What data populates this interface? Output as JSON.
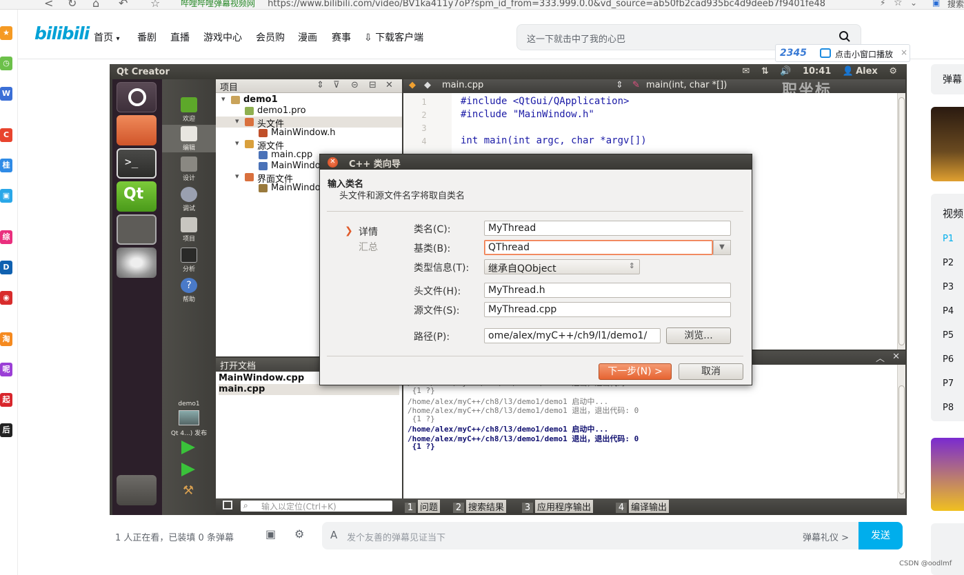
{
  "browser": {
    "site_label": "哔哩哔哩弹幕视频网",
    "url": "https://www.bilibili.com/video/BV1ka411y7oP?spm_id_from=333.999.0.0&vd_source=ab50fb2cad935bc4d9deeb7f9401fe48",
    "search_partial": "搜索"
  },
  "header": {
    "logo": "bilibili",
    "nav": [
      "首页",
      "番剧",
      "直播",
      "游戏中心",
      "会员购",
      "漫画",
      "赛事",
      "下载客户端"
    ],
    "search_placeholder": "这一下就击中了我的心巴",
    "pip_brand": "2345",
    "pip_label": "点击小窗口播放",
    "pip_close": "×"
  },
  "left_strip": {
    "icons": [
      {
        "name": "favorite-star-icon",
        "glyph": "★",
        "color": "#f59a23"
      },
      {
        "name": "clock-icon",
        "glyph": "◷",
        "color": "#6cc04a"
      },
      {
        "name": "pdf-to-word-icon",
        "glyph": "W",
        "color": "#3b6fd6"
      },
      {
        "name": "c-app-icon",
        "glyph": "C",
        "color": "#e8442e"
      },
      {
        "name": "gui-app-icon",
        "glyph": "桂",
        "color": "#2f8be6"
      },
      {
        "name": "bilibili-tv-icon",
        "glyph": "▣",
        "color": "#2aa7e8"
      },
      {
        "name": "pink-app-icon",
        "glyph": "综",
        "color": "#ea2f7e"
      },
      {
        "name": "decathlon-icon",
        "glyph": "D",
        "color": "#1061b0"
      },
      {
        "name": "red-circle-app-icon",
        "glyph": "◉",
        "color": "#d82c2c"
      },
      {
        "name": "orange-app-icon",
        "glyph": "淘",
        "color": "#f58a1f"
      },
      {
        "name": "purple-app-icon",
        "glyph": "呢",
        "color": "#9b3fd6"
      },
      {
        "name": "qidian-icon",
        "glyph": "起",
        "color": "#d8262c"
      },
      {
        "name": "black-app-icon",
        "glyph": "后",
        "color": "#222222"
      }
    ]
  },
  "qt": {
    "topbar_title": "Qt Creator",
    "topbar_time": "10:41",
    "topbar_user": "Alex",
    "modes": [
      "欢迎",
      "编辑",
      "设计",
      "调试",
      "项目",
      "分析",
      "帮助"
    ],
    "project_name": "demo1",
    "build_target": "Qt 4...) 发布",
    "project_header": "项目",
    "tree": [
      {
        "label": "demo1",
        "indent": 0,
        "bold": true,
        "expander": "▾",
        "icon": "#c9a35a"
      },
      {
        "label": "demo1.pro",
        "indent": 1,
        "bold": false,
        "expander": "",
        "icon": "#8fb050"
      },
      {
        "label": "头文件",
        "indent": 1,
        "bold": false,
        "expander": "▾",
        "icon": "#d9703d",
        "selected": true
      },
      {
        "label": "MainWindow.h",
        "indent": 2,
        "bold": false,
        "expander": "",
        "icon": "#c0502a"
      },
      {
        "label": "源文件",
        "indent": 1,
        "bold": false,
        "expander": "▾",
        "icon": "#d9a03d"
      },
      {
        "label": "main.cpp",
        "indent": 2,
        "bold": false,
        "expander": "",
        "icon": "#4a72b8"
      },
      {
        "label": "MainWindow.cpp",
        "indent": 2,
        "bold": false,
        "expander": "",
        "icon": "#4a72b8"
      },
      {
        "label": "界面文件",
        "indent": 1,
        "bold": false,
        "expander": "▾",
        "icon": "#d9703d"
      },
      {
        "label": "MainWindow.ui",
        "indent": 2,
        "bold": false,
        "expander": "",
        "icon": "#9a7a3d"
      }
    ],
    "open_docs_header": "打开文档",
    "open_docs": [
      "MainWindow.cpp",
      "main.cpp"
    ],
    "editor_file": "main.cpp",
    "editor_function": "main(int, char *[])",
    "code_lines": [
      {
        "n": "1",
        "text": "#include <QtGui/QApplication>"
      },
      {
        "n": "2",
        "text": "#include \"MainWindow.h\""
      },
      {
        "n": "3",
        "text": ""
      },
      {
        "n": "4",
        "text": "int main(int argc, char *argv[])"
      }
    ],
    "output_lines": [
      {
        "text": "/home/alex/myC++/ch8/l3/demo1/demo1 启动中...",
        "bold": false
      },
      {
        "text": "/home/alex/myC++/ch8/l3/demo1/demo1 退出，退出代码: 0",
        "bold": false
      },
      {
        "text": " {1 ?}",
        "bold": false
      },
      {
        "text": "/home/alex/myC++/ch8/l3/demo1/demo1 启动中...",
        "bold": false
      },
      {
        "text": "/home/alex/myC++/ch8/l3/demo1/demo1 退出，退出代码: 0",
        "bold": false
      },
      {
        "text": " {1 ?}",
        "bold": false
      },
      {
        "text": "/home/alex/myC++/ch8/l3/demo1/demo1 启动中...",
        "bold": true
      },
      {
        "text": "/home/alex/myC++/ch8/l3/demo1/demo1 退出，退出代码: 0",
        "bold": true
      },
      {
        "text": " {1 ?}",
        "bold": true
      }
    ],
    "locator_placeholder": "输入以定位(Ctrl+K)",
    "output_tabs": [
      {
        "num": "1",
        "label": "问题"
      },
      {
        "num": "2",
        "label": "搜索结果"
      },
      {
        "num": "3",
        "label": "应用程序输出"
      },
      {
        "num": "4",
        "label": "编译输出"
      }
    ],
    "watermark": "职坐标"
  },
  "dialog": {
    "title": "C++ 类向导",
    "heading": "输入类名",
    "subheading": "头文件和源文件名字将取自类名",
    "steps": [
      "详情",
      "汇总"
    ],
    "fields": {
      "class_name_label": "类名(C):",
      "class_name": "MyThread",
      "base_class_label": "基类(B):",
      "base_class": "QThread",
      "type_info_label": "类型信息(T):",
      "type_info": "继承自QObject",
      "header_label": "头文件(H):",
      "header_file": "MyThread.h",
      "source_label": "源文件(S):",
      "source_file": "MyThread.cpp",
      "path_label": "路径(P):",
      "path": "ome/alex/myC++/ch9/l1/demo1/"
    },
    "browse": "浏览...",
    "next": "下一步(N) >",
    "cancel": "取消"
  },
  "danmaku": {
    "watching": "1 人正在看，已装填 0 条弹幕",
    "placeholder": "发个友善的弹幕见证当下",
    "etiquette": "弹幕礼仪 >",
    "send": "发送"
  },
  "sidebar": {
    "danmaku_partial": "弹幕",
    "video_partial": "视频",
    "parts": [
      "P1",
      "P2",
      "P3",
      "P4",
      "P5",
      "P6",
      "P7",
      "P8"
    ]
  },
  "footer": {
    "csdn": "CSDN @oodlmf"
  }
}
